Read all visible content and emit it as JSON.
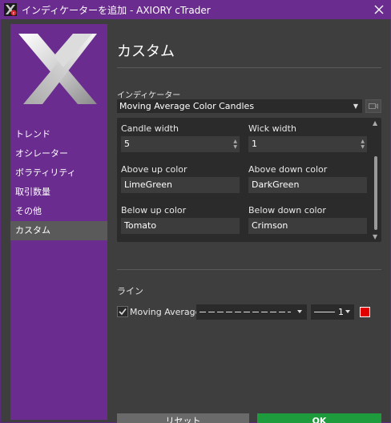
{
  "window": {
    "title": "インディケーターを追加 - AXIORY cTrader"
  },
  "sidebar": {
    "items": [
      {
        "label": "トレンド"
      },
      {
        "label": "オシレーター"
      },
      {
        "label": "ボラティリティ"
      },
      {
        "label": "取引数量"
      },
      {
        "label": "その他"
      },
      {
        "label": "カスタム",
        "active": true
      }
    ]
  },
  "main": {
    "title": "カスタム",
    "indicator_label": "インディケーター",
    "indicator_value": "Moving Average Color Candles",
    "params": {
      "candle_width": {
        "label": "Candle width",
        "value": "5"
      },
      "wick_width": {
        "label": "Wick width",
        "value": "1"
      },
      "above_up_color": {
        "label": "Above up color",
        "value": "LimeGreen"
      },
      "above_down_color": {
        "label": "Above down color",
        "value": "DarkGreen"
      },
      "below_up_color": {
        "label": "Below up color",
        "value": "Tomato"
      },
      "below_down_color": {
        "label": "Below down color",
        "value": "Crimson"
      }
    },
    "lines": {
      "label": "ライン",
      "item": {
        "label": "Moving Average",
        "checked": true,
        "width": "1",
        "color": "#e00000"
      }
    }
  },
  "footer": {
    "reset_label": "リセット",
    "ok_label": "OK"
  },
  "colors": {
    "accent": "#6a2c8e",
    "ok": "#1e9b3c",
    "bg": "#3e3e3e"
  }
}
